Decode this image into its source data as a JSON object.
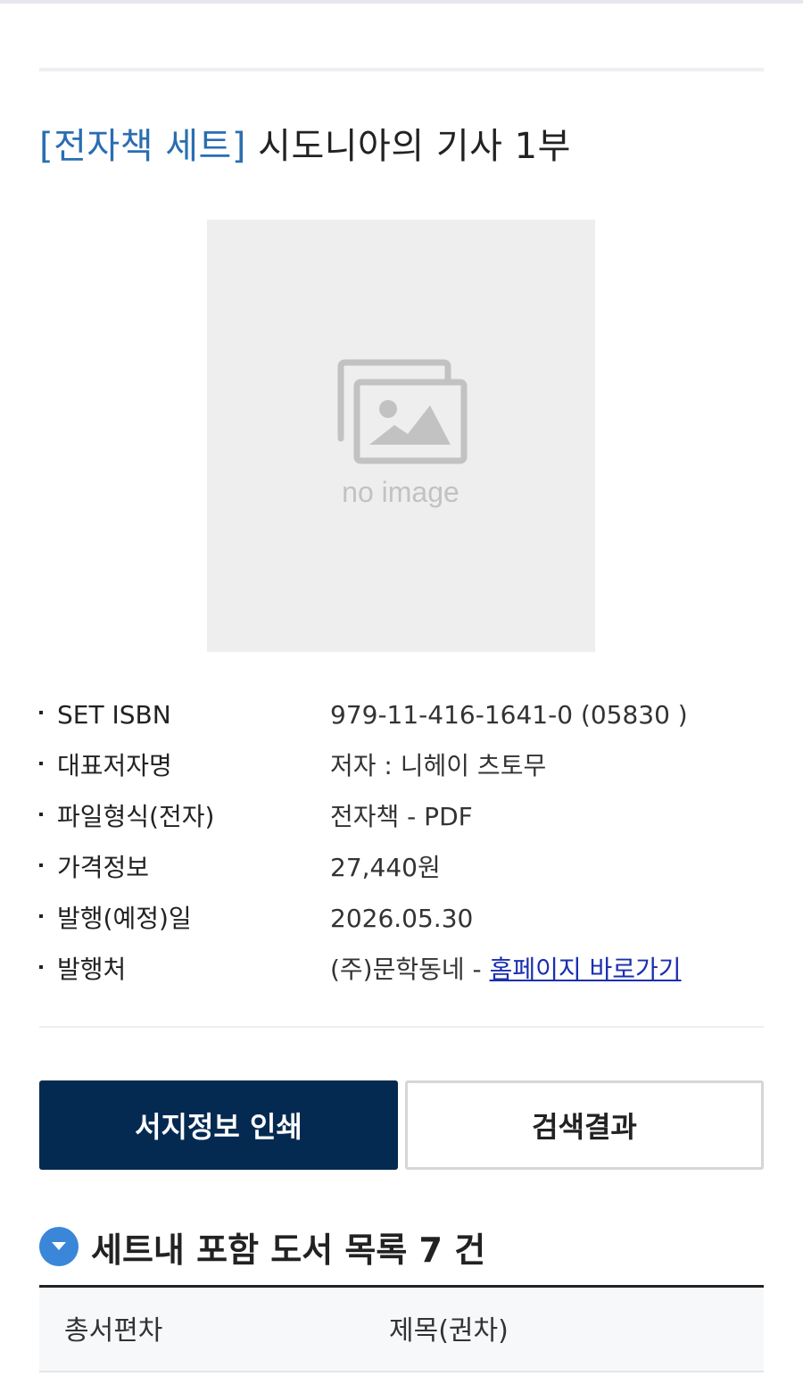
{
  "book": {
    "title_prefix": "[전자책 세트]",
    "title": "시도니아의 기사 1부",
    "cover_placeholder": "no image"
  },
  "meta": [
    {
      "label": "SET ISBN",
      "value": "979-11-416-1641-0 (05830 )"
    },
    {
      "label": "대표저자명",
      "value": "저자 : 니헤이 츠토무"
    },
    {
      "label": "파일형식(전자)",
      "value": "전자책 - PDF"
    },
    {
      "label": "가격정보",
      "value": "27,440원"
    },
    {
      "label": "발행(예정)일",
      "value": "2026.05.30"
    },
    {
      "label": "발행처",
      "value": "(주)문학동네 - ",
      "link": "홈페이지 바로가기"
    }
  ],
  "buttons": {
    "print": "서지정보 인쇄",
    "results": "검색결과"
  },
  "set_list": {
    "heading": "세트내 포함 도서 목록 7 건",
    "columns": [
      "총서편차",
      "제목(권차)"
    ]
  },
  "colors": {
    "accent": "#2a6eb0",
    "button_dark": "#052a52",
    "link": "#1a2fb0",
    "circle": "#3a86d9"
  }
}
